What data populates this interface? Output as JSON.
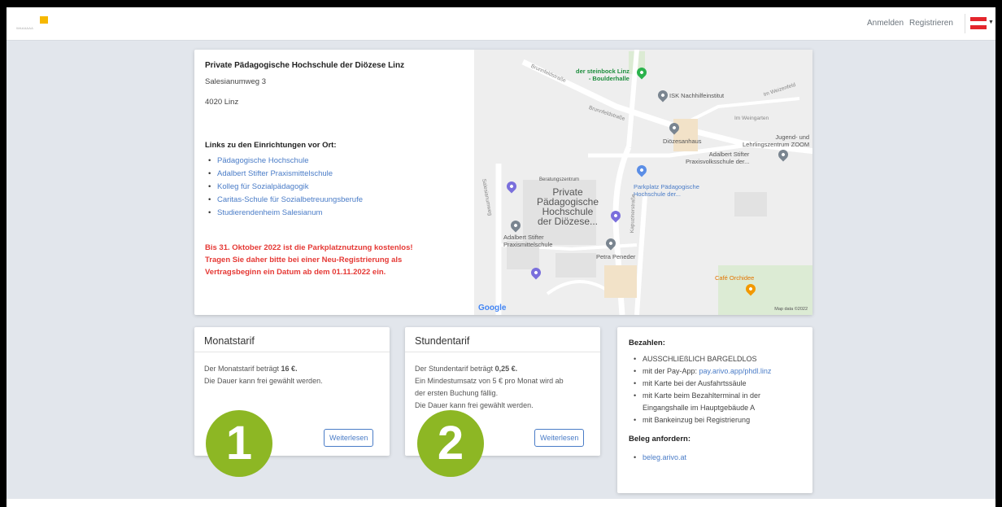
{
  "navbar": {
    "logo_text": "WAAAAAA",
    "login": "Anmelden",
    "register": "Registrieren",
    "flag_colors": [
      "#e4252c",
      "#ffffff",
      "#e4252c"
    ]
  },
  "address": {
    "title": "Private Pädagogische Hochschule der Diözese Linz",
    "street": "Salesianumweg 3",
    "city": "4020 Linz",
    "links_heading": "Links zu den Einrichtungen vor Ort:",
    "links": [
      "Pädagogische Hochschule",
      "Adalbert Stifter Praxismittelschule",
      "Kolleg für Sozialpädagogik",
      "Caritas-Schule für Sozialbetreuungsberufe",
      "Studierendenheim Salesianum"
    ],
    "warning_lines": [
      "Bis 31. Oktober 2022 ist die Parkplatznutzung kostenlos!",
      "Tragen Sie daher bitte bei einer Neu-Registrierung als",
      "Vertragsbeginn ein Datum ab dem 01.11.2022 ein."
    ],
    "warning_color": "#e53935"
  },
  "map": {
    "labels": {
      "steinbock": "der steinbock Linz\n- Boulderhalle",
      "isk": "ISK Nachhilfeinstitut",
      "weizenfeld": "Im Weizenfeld",
      "weingarten": "Im Weingarten",
      "dioezesan": "Diözesanhaus",
      "jugend": "Jugend- und\nLehrlingszentrum ZOOM",
      "adalbert_volks": "Adalbert Stifter\nPraxisvolksschule der...",
      "beratung": "Beratungszentrum",
      "hochschule": "Private\nPädagogische\nHochschule\nder Diözese...",
      "parkplatz": "Parkplatz Pädagogische\nHochschule der...",
      "adalbert_mittel": "Adalbert Stifter\nPraxismittelschule",
      "peneder": "Petra Peneder",
      "cafe": "Café Orchidee",
      "kapuziner": "Kapuzinerstraße",
      "salesianum": "Salesianumweg",
      "brunnfeld1": "Brunnfeldstraße",
      "brunnfeld2": "Brunnfeldstraße"
    },
    "google": "Google",
    "map_data": "Map data ©2022"
  },
  "monthly": {
    "title": "Monatstarif",
    "line1_prefix": "Der Monatstarif beträgt ",
    "line1_value": "16 €.",
    "line2": "Die Dauer kann frei gewählt werden.",
    "button": "Weiterlesen",
    "badge": "1"
  },
  "hourly": {
    "title": "Stundentarif",
    "line1_prefix": "Der Stundentarif beträgt ",
    "line1_value": "0,25 €.",
    "line2": "Ein Mindestumsatz von 5 € pro Monat wird ab",
    "line3": "der ersten Buchung fällig.",
    "line4": "Die Dauer kann frei gewählt werden.",
    "button": "Weiterlesen",
    "badge": "2"
  },
  "payment": {
    "heading": "Bezahlen:",
    "item1": "AUSSCHLIEßLICH BARGELDLOS",
    "item2_prefix": "mit der Pay-App: ",
    "item2_link": "pay.arivo.app/phdl.linz",
    "item3": "mit Karte bei der Ausfahrtssäule",
    "item4a": "mit Karte beim Bezahlterminal in der",
    "item4b": "Eingangshalle im Hauptgebäude A",
    "item5": "mit Bankeinzug bei Registrierung",
    "receipt_heading": "Beleg anfordern:",
    "receipt_link": "beleg.arivo.at"
  },
  "colors": {
    "badge_green": "#8db724",
    "link_blue": "#4a7cc7",
    "background": "#e2e6ec"
  }
}
